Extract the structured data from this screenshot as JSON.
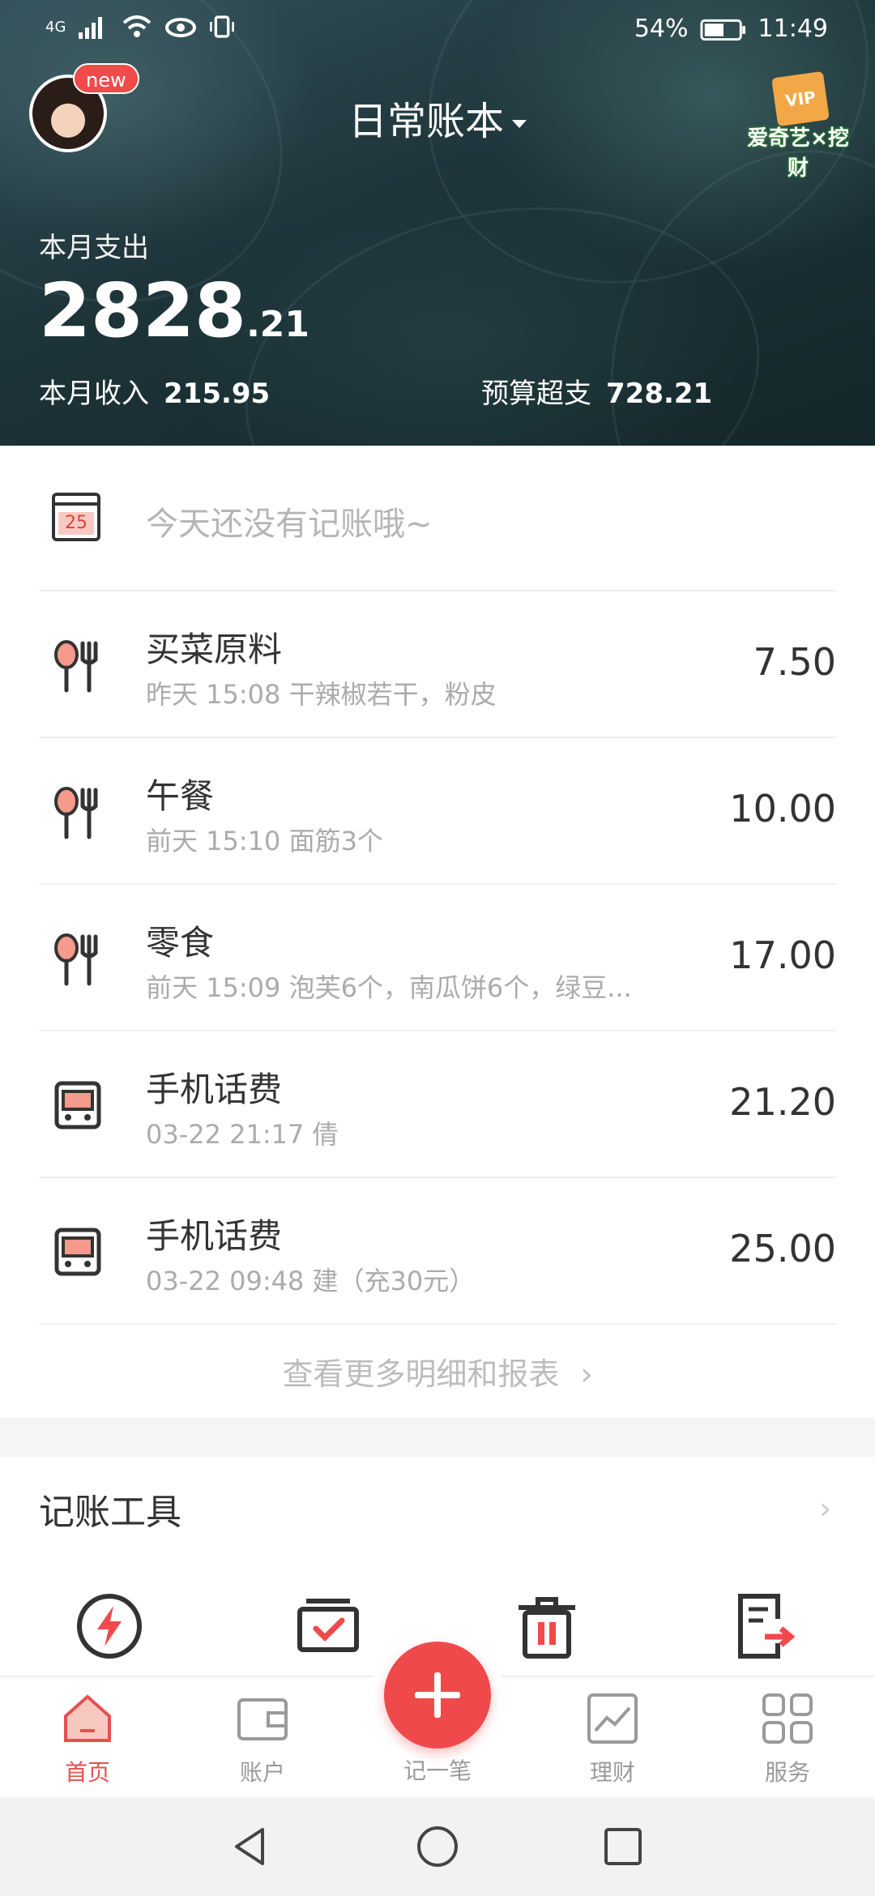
{
  "status_bar": {
    "network": "4G",
    "battery": "54%",
    "time": "11:49"
  },
  "header": {
    "avatar_badge": "new",
    "book_name": "日常账本",
    "promo_text": "爱奇艺×挖财",
    "promo_box_text": "VIP",
    "expense_label": "本月支出",
    "expense_integer": "2828",
    "expense_decimal": ".21",
    "income_label": "本月收入",
    "income_value": "215.95",
    "budget_label": "预算超支",
    "budget_value": "728.21"
  },
  "today": {
    "calendar_day": "25",
    "message": "今天还没有记账哦~"
  },
  "transactions": [
    {
      "icon": "dining-icon",
      "title": "买菜原料",
      "subtitle": "昨天 15:08 干辣椒若干，粉皮",
      "amount": "7.50"
    },
    {
      "icon": "dining-icon",
      "title": "午餐",
      "subtitle": "前天 15:10 面筋3个",
      "amount": "10.00"
    },
    {
      "icon": "dining-icon",
      "title": "零食",
      "subtitle": "前天 15:09 泡芙6个，南瓜饼6个，绿豆...",
      "amount": "17.00"
    },
    {
      "icon": "bus-icon",
      "title": "手机话费",
      "subtitle": "03-22 21:17 倩",
      "amount": "21.20"
    },
    {
      "icon": "bus-icon",
      "title": "手机话费",
      "subtitle": "03-22 09:48 建（充30元）",
      "amount": "25.00"
    }
  ],
  "more_link": "查看更多明细和报表",
  "tools": {
    "title": "记账工具",
    "items": [
      "lightning-icon",
      "checklist-icon",
      "trash-icon",
      "export-icon"
    ]
  },
  "bottom_nav": {
    "items": [
      {
        "label": "首页",
        "icon": "home-icon",
        "active": true
      },
      {
        "label": "账户",
        "icon": "wallet-icon",
        "active": false
      },
      {
        "label": "记一笔",
        "icon": "plus-icon",
        "active": false
      },
      {
        "label": "理财",
        "icon": "chart-icon",
        "active": false
      },
      {
        "label": "服务",
        "icon": "grid-icon",
        "active": false
      }
    ]
  },
  "colors": {
    "accent": "#f0494b",
    "header_dark": "#1d3439",
    "text_primary": "#333333",
    "text_secondary": "#ababab"
  }
}
